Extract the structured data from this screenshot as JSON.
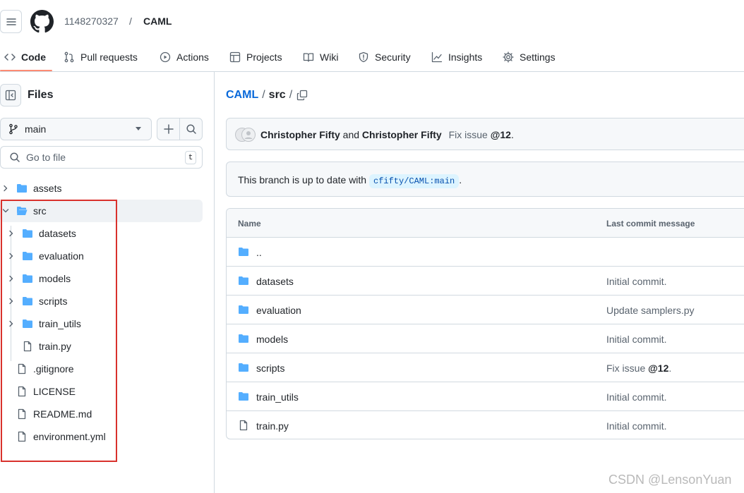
{
  "header": {
    "owner": "1148270327",
    "separator": "/",
    "repo": "CAML"
  },
  "tabs": [
    {
      "label": "Code",
      "icon": "code-icon",
      "active": true
    },
    {
      "label": "Pull requests",
      "icon": "pull-request-icon"
    },
    {
      "label": "Actions",
      "icon": "play-icon"
    },
    {
      "label": "Projects",
      "icon": "table-icon"
    },
    {
      "label": "Wiki",
      "icon": "book-icon"
    },
    {
      "label": "Security",
      "icon": "shield-icon"
    },
    {
      "label": "Insights",
      "icon": "graph-icon"
    },
    {
      "label": "Settings",
      "icon": "gear-icon"
    }
  ],
  "sidebar": {
    "title": "Files",
    "branch": "main",
    "goto_placeholder": "Go to file",
    "goto_shortcut": "t",
    "tree": [
      {
        "label": "assets",
        "type": "folder",
        "expanded": false
      },
      {
        "label": "src",
        "type": "folder",
        "expanded": true,
        "selected": true
      },
      {
        "label": "datasets",
        "type": "folder",
        "expanded": false
      },
      {
        "label": "evaluation",
        "type": "folder",
        "expanded": false
      },
      {
        "label": "models",
        "type": "folder",
        "expanded": false
      },
      {
        "label": "scripts",
        "type": "folder",
        "expanded": false
      },
      {
        "label": "train_utils",
        "type": "folder",
        "expanded": false
      },
      {
        "label": "train.py",
        "type": "file"
      },
      {
        "label": ".gitignore",
        "type": "file"
      },
      {
        "label": "LICENSE",
        "type": "file"
      },
      {
        "label": "README.md",
        "type": "file"
      },
      {
        "label": "environment.yml",
        "type": "file"
      }
    ]
  },
  "main": {
    "path_repo": "CAML",
    "path_sep": "/",
    "path_seg": "src",
    "path_trailing": "/",
    "commit": {
      "author1": "Christopher Fifty",
      "and": "and",
      "author2": "Christopher Fifty",
      "message": "Fix issue",
      "ref": "@12",
      "period": "."
    },
    "branch_status": {
      "text": "This branch is up to date with",
      "ref": "cfifty/CAML:main",
      "period": "."
    },
    "table": {
      "col_name": "Name",
      "col_msg": "Last commit message",
      "rows": [
        {
          "name": "..",
          "type": "folder",
          "msg": "",
          "msg_ref": ""
        },
        {
          "name": "datasets",
          "type": "folder",
          "msg": "Initial commit.",
          "msg_ref": ""
        },
        {
          "name": "evaluation",
          "type": "folder",
          "msg": "Update samplers.py",
          "msg_ref": ""
        },
        {
          "name": "models",
          "type": "folder",
          "msg": "Initial commit.",
          "msg_ref": ""
        },
        {
          "name": "scripts",
          "type": "folder",
          "msg": "Fix issue ",
          "msg_ref": "@12",
          "msg_tail": "."
        },
        {
          "name": "train_utils",
          "type": "folder",
          "msg": "Initial commit.",
          "msg_ref": ""
        },
        {
          "name": "train.py",
          "type": "file",
          "msg": "Initial commit.",
          "msg_ref": ""
        }
      ]
    }
  },
  "watermark": "CSDN @LensonYuan",
  "colors": {
    "accent_link": "#0969da",
    "folder": "#54aeff",
    "tab_underline": "#fd8c73",
    "highlight_box": "#d9312c"
  }
}
